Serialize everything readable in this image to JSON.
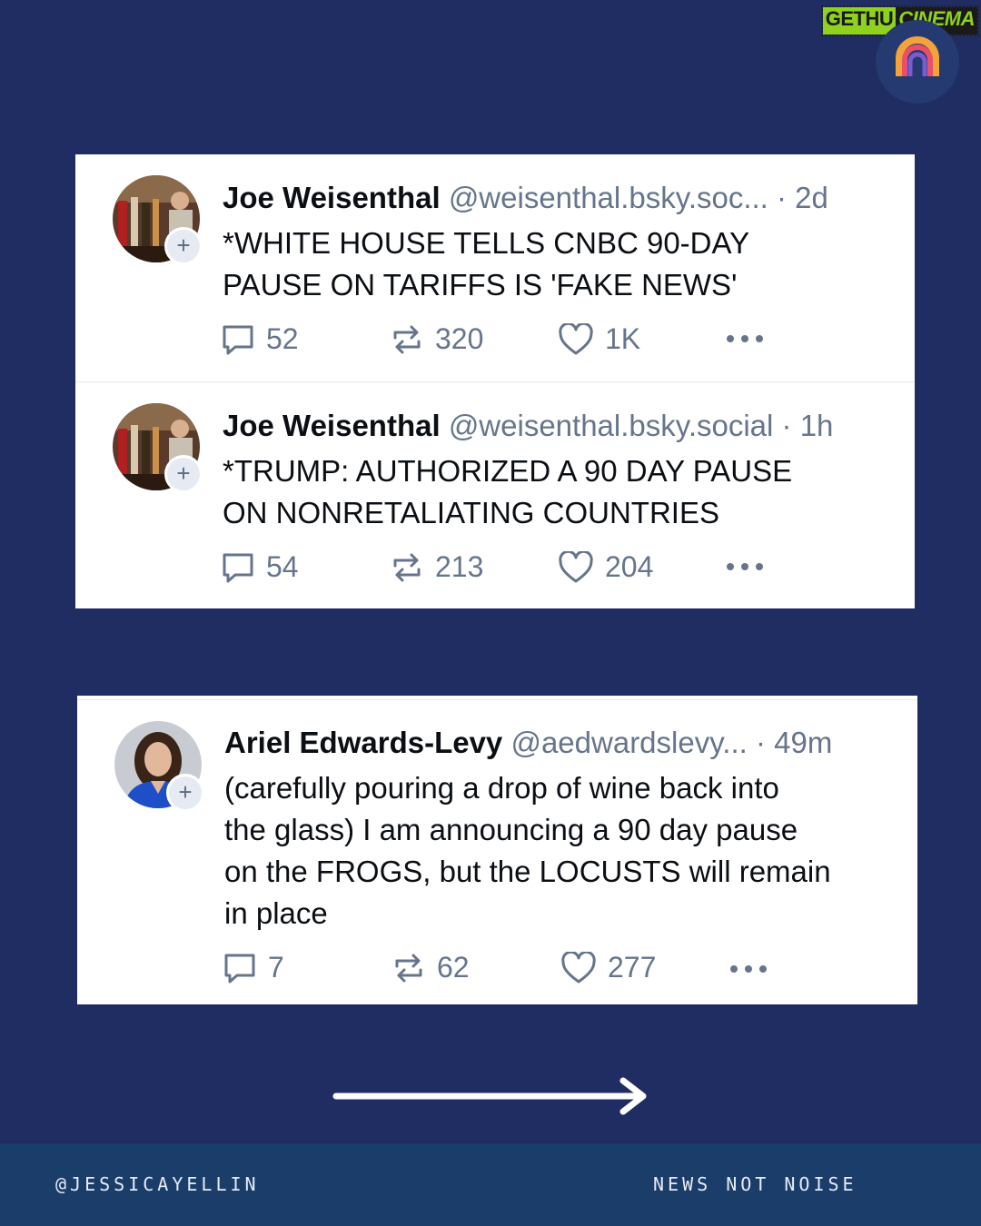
{
  "watermark": {
    "part1": "GETHU",
    "part2": "CINEMA"
  },
  "posts": [
    {
      "name": "Joe Weisenthal",
      "handle": "@weisenthal.bsky.soc...",
      "time": "· 2d",
      "text_line1": "*WHITE HOUSE TELLS CNBC 90-DAY",
      "text_line2": "PAUSE ON TARIFFS IS 'FAKE NEWS'",
      "replies": "52",
      "reposts": "320",
      "likes": "1K"
    },
    {
      "name": "Joe Weisenthal",
      "handle": "@weisenthal.bsky.social",
      "time": "· 1h",
      "text_line1": "*TRUMP: AUTHORIZED A 90 DAY PAUSE",
      "text_line2": "ON NONRETALIATING COUNTRIES",
      "replies": "54",
      "reposts": "213",
      "likes": "204"
    },
    {
      "name": "Ariel Edwards-Levy",
      "handle": "@aedwardslevy...",
      "time": "· 49m",
      "text_line1": "(carefully pouring a drop of wine back into",
      "text_line2": "the glass) I am announcing a 90 day pause",
      "text_line3": "on the FROGS, but the LOCUSTS will remain",
      "text_line4": "in place",
      "replies": "7",
      "reposts": "62",
      "likes": "277"
    }
  ],
  "footer": {
    "left": "@JESSICAYELLIN",
    "right": "NEWS NOT NOISE"
  },
  "colors": {
    "background": "#1f2d63",
    "footer": "#1a3d6a",
    "card": "#ffffff",
    "meta": "#66758c"
  }
}
